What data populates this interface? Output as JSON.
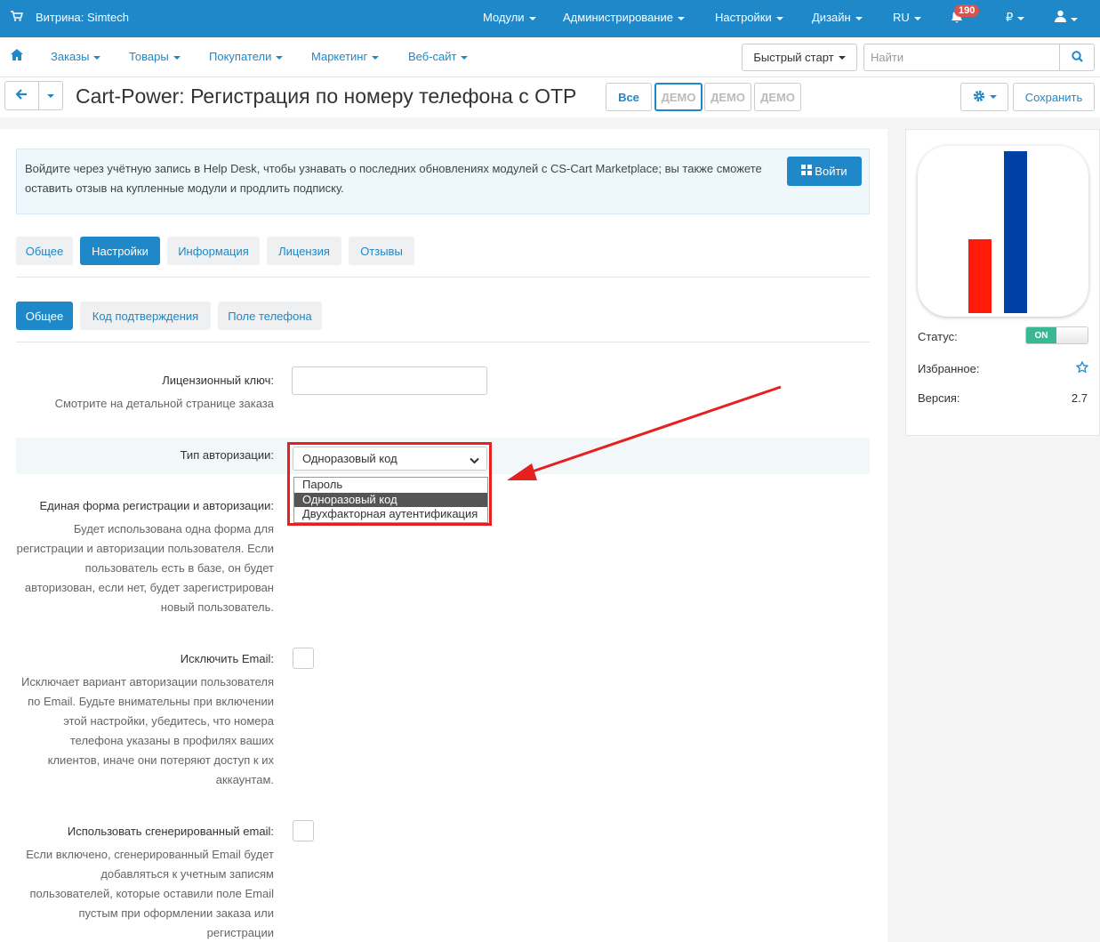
{
  "topbar": {
    "store": "Витрина: Simtech",
    "menus": [
      "Модули",
      "Администрирование",
      "Настройки",
      "Дизайн",
      "RU",
      "₽"
    ],
    "notif_count": "190"
  },
  "nav": {
    "items": [
      "Заказы",
      "Товары",
      "Покупатели",
      "Маркетинг",
      "Веб-сайт"
    ],
    "quick_start": "Быстрый старт",
    "search_placeholder": "Найти"
  },
  "header": {
    "title": "Cart-Power: Регистрация по номеру телефона с OTP",
    "all_label": "Все",
    "demo_label": "ДЕМО",
    "save_label": "Сохранить"
  },
  "notice": {
    "text": "Войдите через учётную запись в Help Desk, чтобы узнавать о последних обновлениях модулей с CS-Cart Marketplace; вы также сможете оставить отзыв на купленные модули и продлить подписку.",
    "login_label": "Войти"
  },
  "tabs": [
    "Общее",
    "Настройки",
    "Информация",
    "Лицензия",
    "Отзывы"
  ],
  "subtabs": [
    "Общее",
    "Код подтверждения",
    "Поле телефона"
  ],
  "fields": {
    "license_label": "Лицензионный ключ:",
    "license_desc": "Смотрите на детальной странице заказа",
    "auth_label": "Тип авторизации:",
    "auth_value": "Одноразовый код",
    "auth_options": [
      "Пароль",
      "Одноразовый код",
      "Двухфакторная аутентификация"
    ],
    "unified_label": "Единая форма регистрации и авторизации:",
    "unified_desc": "Будет использована одна форма для регистрации и авторизации пользователя. Если пользователь есть в базе, он будет авторизован, если нет, будет зарегистрирован новый пользователь.",
    "exclude_label": "Исключить Email:",
    "exclude_desc": "Исключает вариант авторизации пользователя по Email. Будьте внимательны при включении этой настройки, убедитесь, что номера телефона указаны в профилях ваших клиентов, иначе они потеряют доступ к их аккаунтам.",
    "gen_label": "Использовать сгенерированный email:",
    "gen_desc": "Если включено, сгенерированный Email будет добавляться к учетным записям пользователей, которые оставили поле Email пустым при оформлении заказа или регистрации"
  },
  "sidebar": {
    "status_label": "Статус:",
    "status_value": "ON",
    "favorite_label": "Избранное:",
    "version_label": "Версия:",
    "version_value": "2.7"
  },
  "colors": {
    "accent": "#1e88c8",
    "highlight_red": "#e61f1f",
    "status_on": "#3ab795",
    "logo_red": "#ff1a0a",
    "logo_blue": "#003fa3"
  }
}
